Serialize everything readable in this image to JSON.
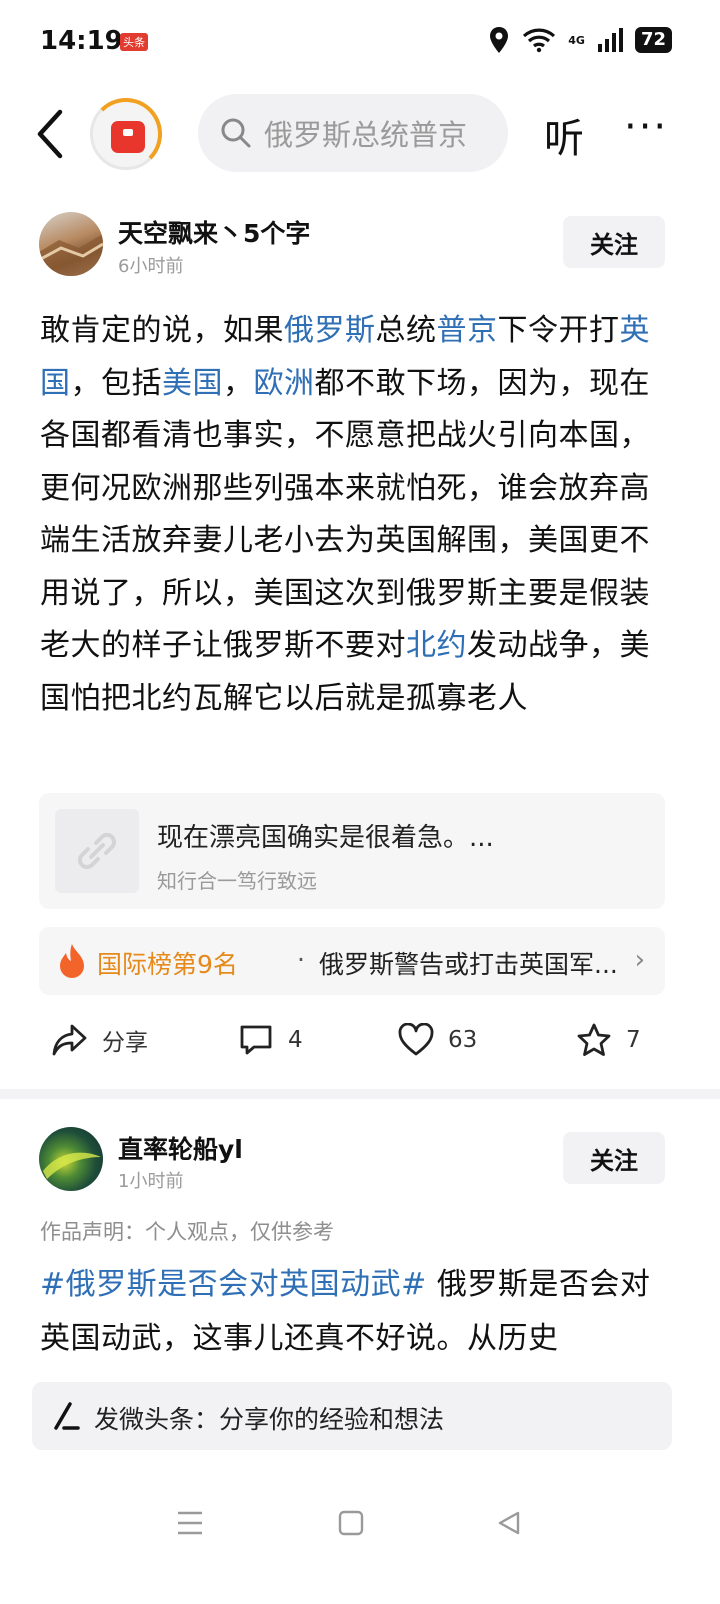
{
  "status_bar": {
    "time": "14:19",
    "app_badge": "头条",
    "network": "4G",
    "battery": "72"
  },
  "header": {
    "search_placeholder": "俄罗斯总统普京",
    "listen_label": "听",
    "more_label": "···"
  },
  "post1": {
    "author": "天空飘来丶5个字",
    "time": "6小时前",
    "follow_label": "关注",
    "body": {
      "s1": "敢肯定的说，如果",
      "k1": "俄罗斯",
      "s2": "总统",
      "k2": "普京",
      "s3": "下令开打",
      "k3": "英国",
      "s4": "，包括",
      "k4": "美国",
      "s5": "，",
      "k5": "欧洲",
      "s6": "都不敢下场，因为，现在各国都看清也事实，不愿意把战火引向本国，更何况欧洲那些列强本来就怕死，谁会放弃高端生活放弃妻儿老小去为英国解围，美国更不用说了，所以，美国这次到俄罗斯主要是假装老大的样子让俄罗斯不要对",
      "k6": "北约",
      "s7": "发动战争，美国怕把北约瓦解它以后就是孤寡老人"
    },
    "reference": {
      "title": "现在漂亮国确实是很着急。...",
      "source": "知行合一笃行致远"
    },
    "rank": {
      "label": "国际榜第9名",
      "dot": "·",
      "text": "俄罗斯警告或打击英国军..."
    },
    "actions": {
      "share": "分享",
      "comments": "4",
      "likes": "63",
      "favorites": "7"
    }
  },
  "post2": {
    "author": "直率轮船yl",
    "time": "1小时前",
    "follow_label": "关注",
    "declaration": "作品声明：个人观点，仅供参考",
    "hashtag": "#俄罗斯是否会对英国动武#",
    "body": " 俄罗斯是否会对英国动武，这事儿还真不好说。从历史"
  },
  "compose": {
    "placeholder": "发微头条：分享你的经验和想法"
  },
  "colors": {
    "link": "#2f6fb6",
    "rank_orange": "#e58a1a",
    "logo_red": "#e8362c"
  }
}
